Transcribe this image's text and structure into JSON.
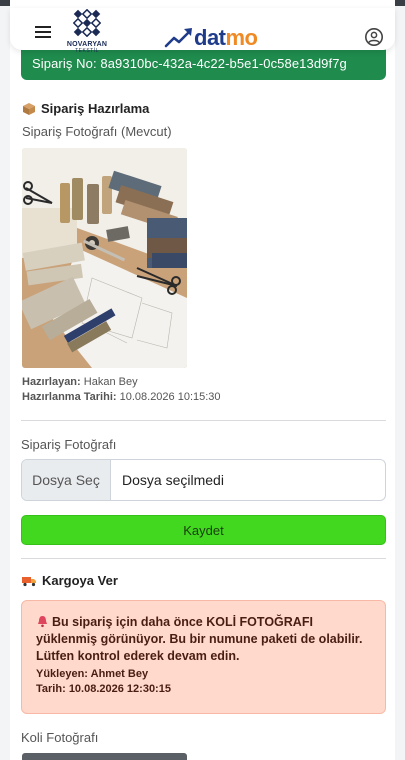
{
  "header": {
    "menu_icon": "hamburger-icon",
    "company_name": "NOVARYAN",
    "company_sub": "TEKSTİL",
    "app_name_part1": "dat",
    "app_name_part2": "mo",
    "user_icon": "user-circle-icon"
  },
  "order": {
    "label": "Sipariş No: 8a9310bc-432a-4c22-b5e1-0c58e13d9f7g"
  },
  "preparation": {
    "icon": "box-icon",
    "title": "Sipariş Hazırlama",
    "photo_label": "Sipariş Fotoğrafı (Mevcut)",
    "prepared_by_label": "Hazırlayan:",
    "prepared_by": "Hakan Bey",
    "prepared_date_label": "Hazırlanma Tarihi:",
    "prepared_date": "10.08.2026 10:15:30"
  },
  "upload": {
    "label": "Sipariş Fotoğrafı",
    "choose_button": "Dosya Seç",
    "file_value": "Dosya seçilmedi",
    "save_button": "Kaydet"
  },
  "shipping": {
    "icon": "truck-icon",
    "title": "Kargoya Ver",
    "warning_icon": "bell-icon",
    "warning_pre": "Bu sipariş için daha önce ",
    "warning_em": "KOLİ FOTOĞRAFI",
    "warning_post": " yüklenmiş görünüyor. Bu bir numune paketi de olabilir. Lütfen kontrol ederek devam edin.",
    "uploader_label": "Yükleyen:",
    "uploader": "Ahmet Bey",
    "date_label": "Tarih:",
    "date": "10.08.2026 12:30:15",
    "box_photo_label": "Koli Fotoğrafı"
  },
  "colors": {
    "order_bar": "#1f8b4d",
    "save_button": "#41d81f",
    "warning_bg": "#ffd9cc",
    "brand_blue": "#1f3c8b",
    "brand_orange": "#f08a24"
  }
}
